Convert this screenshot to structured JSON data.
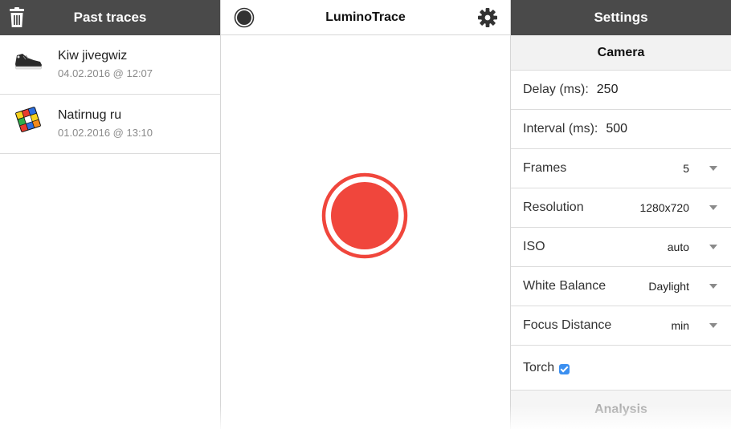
{
  "left_panel": {
    "title": "Past traces",
    "traces": [
      {
        "name": "Kiw jivegwiz",
        "date": "04.02.2016 @ 12:07",
        "thumb": "sneaker-image"
      },
      {
        "name": "Natirnug ru",
        "date": "01.02.2016 @ 13:10",
        "thumb": "rubiks-cube-image"
      }
    ]
  },
  "center_panel": {
    "title": "LuminoTrace",
    "record_color": "#f0463c"
  },
  "right_panel": {
    "title": "Settings",
    "camera_section": "Camera",
    "delay": {
      "label": "Delay (ms):",
      "value": "250"
    },
    "interval": {
      "label": "Interval (ms):",
      "value": "500"
    },
    "frames": {
      "label": "Frames",
      "value": "5"
    },
    "resolution": {
      "label": "Resolution",
      "value": "1280x720"
    },
    "iso": {
      "label": "ISO",
      "value": "auto"
    },
    "white_balance": {
      "label": "White Balance",
      "value": "Daylight"
    },
    "focus_distance": {
      "label": "Focus Distance",
      "value": "min"
    },
    "torch": {
      "label": "Torch",
      "checked": true
    },
    "analysis_section": "Analysis"
  },
  "colors": {
    "header_dark": "#4a4a4a",
    "accent_blue": "#3b8ff0",
    "record_red": "#f0463c"
  }
}
